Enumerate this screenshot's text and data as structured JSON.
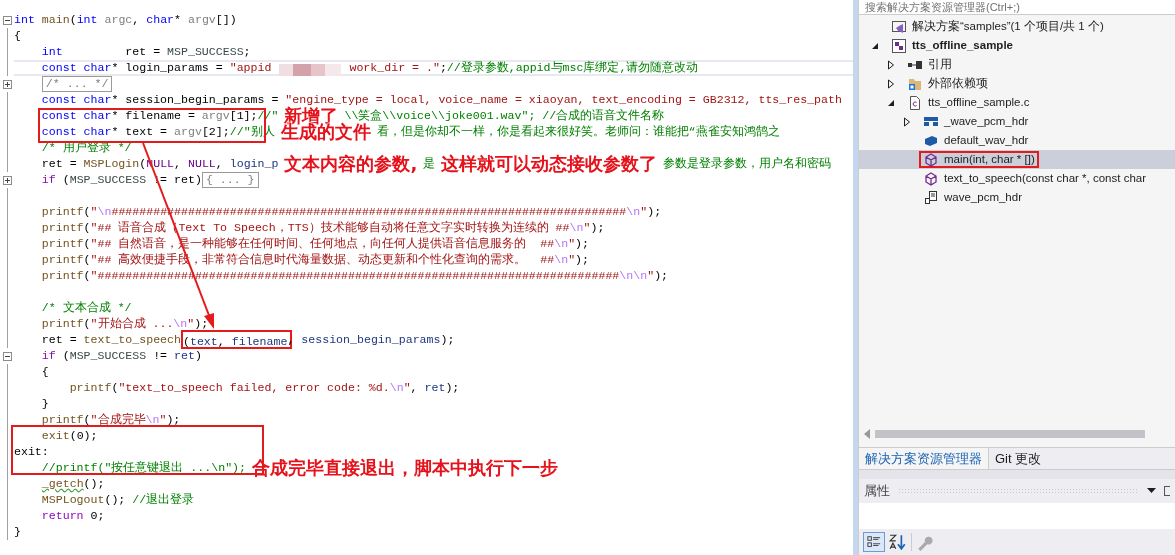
{
  "editor": {
    "lines": [
      {
        "folded": false,
        "current": false,
        "tokens": [
          {
            "kind": "kw",
            "text": "int"
          },
          {
            "kind": "fn",
            "text": " main"
          },
          {
            "kind": "pl",
            "text": "("
          },
          {
            "kind": "kw",
            "text": "int"
          },
          {
            "kind": "prm",
            "text": " argc"
          },
          {
            "kind": "pl",
            "text": ", "
          },
          {
            "kind": "kw",
            "text": "char"
          },
          {
            "kind": "pl",
            "text": "* "
          },
          {
            "kind": "prm",
            "text": "argv"
          },
          {
            "kind": "pl",
            "text": "[])"
          }
        ]
      },
      {
        "current": false,
        "tokens": [
          {
            "kind": "pl",
            "text": "{"
          }
        ]
      },
      {
        "current": false,
        "tokens": [
          {
            "kind": "kw",
            "text": "    int"
          },
          {
            "kind": "pl",
            "text": "         ret = "
          },
          {
            "kind": "mac",
            "text": "MSP_SUCCESS"
          },
          {
            "kind": "pl",
            "text": ";"
          }
        ]
      },
      {
        "current": true,
        "tokens": [
          {
            "kind": "kw",
            "text": "    const char"
          },
          {
            "kind": "pl",
            "text": "* login_params = "
          },
          {
            "kind": "str",
            "text": "\"appid"
          },
          {
            "kind": "blur"
          },
          {
            "kind": "str",
            "text": "work_dir = .\""
          },
          {
            "kind": "pl",
            "text": ";"
          },
          {
            "kind": "cm",
            "text": "//登录参数,appid与msc库绑定,请勿随意改动"
          }
        ]
      },
      {
        "folded": true,
        "current": false,
        "tokens": [
          {
            "kind": "fold",
            "text": "    /* ... */"
          }
        ]
      },
      {
        "current": false,
        "tokens": [
          {
            "kind": "kw",
            "text": "    const char"
          },
          {
            "kind": "pl",
            "text": "* session_begin_params = "
          },
          {
            "kind": "str",
            "text": "\"engine_type = local, voice_name = xiaoyan, text_encoding = GB2312, tts_res_path"
          }
        ]
      },
      {
        "current": false,
        "tokens": [
          {
            "kind": "kw",
            "text": "    const char"
          },
          {
            "kind": "pl",
            "text": "* filename = "
          },
          {
            "kind": "prm",
            "text": "argv"
          },
          {
            "kind": "pl",
            "text": "[1];"
          },
          {
            "kind": "cm",
            "text": "//\""
          },
          {
            "kind": "note",
            "text": "新增了"
          },
          {
            "kind": "cm",
            "text": "\\\\笑盒\\\\voice\\\\joke001.wav\"; //合成的语音文件名称"
          }
        ]
      },
      {
        "current": false,
        "tokens": [
          {
            "kind": "kw",
            "text": "    const char"
          },
          {
            "kind": "pl",
            "text": "* text = "
          },
          {
            "kind": "prm",
            "text": "argv"
          },
          {
            "kind": "pl",
            "text": "[2];"
          },
          {
            "kind": "cm",
            "text": "//\"别人"
          },
          {
            "kind": "note",
            "text": "生成的文件"
          },
          {
            "kind": "cm",
            "text": "看，但是你却不一样，你是看起来很好笑。老师问：谁能把“燕雀安知鸿鹄之"
          }
        ]
      },
      {
        "current": false,
        "tokens": [
          {
            "kind": "cm",
            "text": "    /* 用户登录 */"
          }
        ]
      },
      {
        "current": false,
        "tokens": [
          {
            "kind": "pl",
            "text": "    ret = "
          },
          {
            "kind": "fn",
            "text": "MSPLogin"
          },
          {
            "kind": "pl",
            "text": "("
          },
          {
            "kind": "nul",
            "text": "NULL"
          },
          {
            "kind": "pl",
            "text": ", "
          },
          {
            "kind": "nul",
            "text": "NULL"
          },
          {
            "kind": "pl",
            "text": ", "
          },
          {
            "kind": "var",
            "text": "login_p"
          },
          {
            "kind": "note",
            "text": "文本内容的参数,"
          },
          {
            "kind": "cm",
            "text": "是"
          },
          {
            "kind": "note",
            "text": "这样就可以动态接收参数了"
          },
          {
            "kind": "cm",
            "text": "参数是登录参数，用户名和密码"
          }
        ]
      },
      {
        "folded": true,
        "current": false,
        "tokens": [
          {
            "kind": "ctl",
            "text": "    if"
          },
          {
            "kind": "pl",
            "text": " ("
          },
          {
            "kind": "mac",
            "text": "MSP_SUCCESS"
          },
          {
            "kind": "pl",
            "text": " != ret)"
          },
          {
            "kind": "fold",
            "text": "{ ... }"
          }
        ]
      },
      {
        "current": false
      },
      {
        "current": false,
        "tokens": [
          {
            "kind": "fn",
            "text": "    printf"
          },
          {
            "kind": "pl",
            "text": "("
          },
          {
            "kind": "str",
            "text": "\""
          },
          {
            "kind": "esc",
            "text": "\\n"
          },
          {
            "kind": "str",
            "text": "##########################################################################"
          },
          {
            "kind": "esc",
            "text": "\\n"
          },
          {
            "kind": "str",
            "text": "\""
          },
          {
            "kind": "pl",
            "text": ");"
          }
        ]
      },
      {
        "current": false,
        "tokens": [
          {
            "kind": "fn",
            "text": "    printf"
          },
          {
            "kind": "pl",
            "text": "("
          },
          {
            "kind": "str",
            "text": "\"## 语音合成（Text To Speech，TTS）技术能够自动将任意文字实时转换为连续的 ##"
          },
          {
            "kind": "esc",
            "text": "\\n"
          },
          {
            "kind": "str",
            "text": "\""
          },
          {
            "kind": "pl",
            "text": ");"
          }
        ]
      },
      {
        "current": false,
        "tokens": [
          {
            "kind": "fn",
            "text": "    printf"
          },
          {
            "kind": "pl",
            "text": "("
          },
          {
            "kind": "str",
            "text": "\"## 自然语音，是一种能够在任何时间、任何地点，向任何人提供语音信息服务的  ##"
          },
          {
            "kind": "esc",
            "text": "\\n"
          },
          {
            "kind": "str",
            "text": "\""
          },
          {
            "kind": "pl",
            "text": ");"
          }
        ]
      },
      {
        "current": false,
        "tokens": [
          {
            "kind": "fn",
            "text": "    printf"
          },
          {
            "kind": "pl",
            "text": "("
          },
          {
            "kind": "str",
            "text": "\"## 高效便捷手段，非常符合信息时代海量数据、动态更新和个性化查询的需求。  ##"
          },
          {
            "kind": "esc",
            "text": "\\n"
          },
          {
            "kind": "str",
            "text": "\""
          },
          {
            "kind": "pl",
            "text": ");"
          }
        ]
      },
      {
        "current": false,
        "tokens": [
          {
            "kind": "fn",
            "text": "    printf"
          },
          {
            "kind": "pl",
            "text": "("
          },
          {
            "kind": "str",
            "text": "\"###########################################################################"
          },
          {
            "kind": "esc",
            "text": "\\n\\n"
          },
          {
            "kind": "str",
            "text": "\""
          },
          {
            "kind": "pl",
            "text": ");"
          }
        ]
      },
      {
        "current": false
      },
      {
        "current": false,
        "tokens": [
          {
            "kind": "cm",
            "text": "    /* 文本合成 */"
          }
        ]
      },
      {
        "current": false,
        "tokens": [
          {
            "kind": "fn",
            "text": "    printf"
          },
          {
            "kind": "pl",
            "text": "("
          },
          {
            "kind": "str",
            "text": "\"开始合成 ..."
          },
          {
            "kind": "esc",
            "text": "\\n"
          },
          {
            "kind": "str",
            "text": "\""
          },
          {
            "kind": "pl",
            "text": ");"
          }
        ]
      },
      {
        "current": false,
        "tokens": [
          {
            "kind": "pl",
            "text": "    ret = "
          },
          {
            "kind": "fn",
            "text": "text_to_speech"
          },
          {
            "kind": "boxed",
            "tokens": [
              {
                "kind": "pl",
                "text": "("
              },
              {
                "kind": "var",
                "text": "text"
              },
              {
                "kind": "pl",
                "text": ", "
              },
              {
                "kind": "var",
                "text": "filename"
              }
            ]
          },
          {
            "kind": "pl",
            "text": ", "
          },
          {
            "kind": "var",
            "text": "session_begin_params"
          },
          {
            "kind": "pl",
            "text": ");"
          }
        ]
      },
      {
        "folded": false,
        "current": false,
        "tokens": [
          {
            "kind": "ctl",
            "text": "    if"
          },
          {
            "kind": "pl",
            "text": " ("
          },
          {
            "kind": "mac",
            "text": "MSP_SUCCESS"
          },
          {
            "kind": "pl",
            "text": " != "
          },
          {
            "kind": "var",
            "text": "ret"
          },
          {
            "kind": "pl",
            "text": ")"
          }
        ]
      },
      {
        "current": false,
        "tokens": [
          {
            "kind": "pl",
            "text": "    {"
          }
        ]
      },
      {
        "current": false,
        "tokens": [
          {
            "kind": "fn",
            "text": "        printf"
          },
          {
            "kind": "pl",
            "text": "("
          },
          {
            "kind": "str",
            "text": "\"text_to_speech failed, error code: %d."
          },
          {
            "kind": "esc",
            "text": "\\n"
          },
          {
            "kind": "str",
            "text": "\""
          },
          {
            "kind": "pl",
            "text": ", "
          },
          {
            "kind": "var",
            "text": "ret"
          },
          {
            "kind": "pl",
            "text": ");"
          }
        ]
      },
      {
        "current": false,
        "tokens": [
          {
            "kind": "pl",
            "text": "    }"
          }
        ]
      },
      {
        "current": false,
        "tokens": [
          {
            "kind": "fn",
            "text": "    printf"
          },
          {
            "kind": "pl",
            "text": "("
          },
          {
            "kind": "str",
            "text": "\"合成完毕"
          },
          {
            "kind": "esc",
            "text": "\\n"
          },
          {
            "kind": "str",
            "text": "\""
          },
          {
            "kind": "pl",
            "text": ");"
          }
        ]
      },
      {
        "current": false,
        "tokens": [
          {
            "kind": "fn",
            "text": "    exit"
          },
          {
            "kind": "pl",
            "text": "(0);"
          }
        ]
      },
      {
        "current": false,
        "tokens": [
          {
            "kind": "pl",
            "text": "exit:"
          }
        ]
      },
      {
        "current": false,
        "tokens": [
          {
            "kind": "cm",
            "text": "    //printf(\"按任意键退出 ...\\n\");"
          },
          {
            "kind": "note",
            "text": "合成完毕直接退出，脚本中执行下一步"
          }
        ]
      },
      {
        "current": false,
        "tokens": [
          {
            "kind": "sq",
            "text": "    _getch"
          },
          {
            "kind": "pl",
            "text": "();"
          }
        ]
      },
      {
        "current": false,
        "tokens": [
          {
            "kind": "fn",
            "text": "    MSPLogout"
          },
          {
            "kind": "pl",
            "text": "(); "
          },
          {
            "kind": "cm",
            "text": "//退出登录"
          }
        ]
      },
      {
        "current": false,
        "tokens": [
          {
            "kind": "ctl",
            "text": "    return"
          },
          {
            "kind": "pl",
            "text": " 0;"
          }
        ]
      },
      {
        "current": false,
        "tokens": [
          {
            "kind": "pl",
            "text": "}"
          }
        ]
      }
    ]
  },
  "explorer": {
    "search": {
      "placeholder": "搜索解决方案资源管理器(Ctrl+;)"
    },
    "items": [
      {
        "label": "解决方案“samples”(1 个项目/共 1 个)",
        "kind": "solution",
        "selected": false,
        "highlighted": false
      },
      {
        "label": "tts_offline_sample",
        "kind": "project",
        "expanded": true,
        "selected": false,
        "highlighted": false,
        "children": [
          {
            "label": "引用",
            "kind": "references",
            "expanded": false,
            "selected": false,
            "highlighted": false
          },
          {
            "label": "外部依赖项",
            "kind": "external",
            "expanded": false,
            "selected": false,
            "highlighted": false
          },
          {
            "label": "tts_offline_sample.c",
            "kind": "cfile",
            "expanded": true,
            "selected": false,
            "highlighted": false,
            "children": [
              {
                "label": "_wave_pcm_hdr",
                "kind": "struct",
                "expanded": false,
                "selected": false,
                "highlighted": false
              },
              {
                "label": "default_wav_hdr",
                "kind": "variable",
                "selected": false,
                "highlighted": false
              },
              {
                "label": "main(int, char * [])",
                "kind": "function",
                "selected": true,
                "highlighted": true
              },
              {
                "label": "text_to_speech(const char *, const char",
                "kind": "function",
                "selected": false,
                "highlighted": false
              },
              {
                "label": "wave_pcm_hdr",
                "kind": "typedef",
                "selected": false,
                "highlighted": false
              }
            ]
          }
        ]
      }
    ],
    "tabs": [
      {
        "label": "解决方案资源管理器",
        "selected": true
      },
      {
        "label": "Git 更改",
        "selected": false
      }
    ]
  },
  "properties": {
    "title": "属性"
  }
}
